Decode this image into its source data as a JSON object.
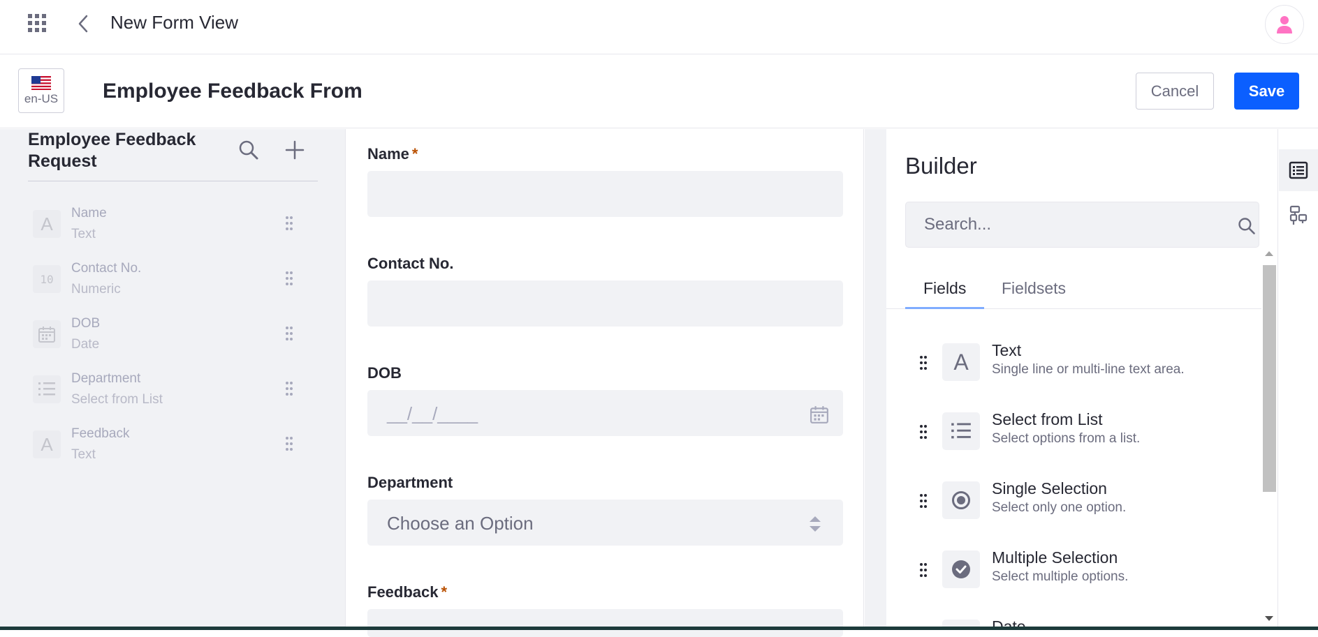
{
  "app": {
    "title": "New Form View"
  },
  "header": {
    "locale": "en-US",
    "form_title": "Employee Feedback From",
    "cancel_label": "Cancel",
    "save_label": "Save"
  },
  "left_panel": {
    "title": "Employee Feedback Request",
    "fields": [
      {
        "name": "Name",
        "type": "Text",
        "icon": "text-icon"
      },
      {
        "name": "Contact No.",
        "type": "Numeric",
        "icon": "numeric-icon"
      },
      {
        "name": "DOB",
        "type": "Date",
        "icon": "calendar-icon"
      },
      {
        "name": "Department",
        "type": "Select from List",
        "icon": "list-icon"
      },
      {
        "name": "Feedback",
        "type": "Text",
        "icon": "text-icon"
      }
    ]
  },
  "canvas": {
    "fields": [
      {
        "label": "Name",
        "required": "*",
        "placeholder": ""
      },
      {
        "label": "Contact No.",
        "required": "",
        "placeholder": ""
      },
      {
        "label": "DOB",
        "required": "",
        "placeholder": "__/__/____"
      },
      {
        "label": "Department",
        "required": "",
        "placeholder": "Choose an Option"
      },
      {
        "label": "Feedback",
        "required": "*",
        "placeholder": ""
      }
    ]
  },
  "builder": {
    "title": "Builder",
    "search_placeholder": "Search...",
    "tabs": [
      {
        "label": "Fields",
        "active": true
      },
      {
        "label": "Fieldsets",
        "active": false
      }
    ],
    "items": [
      {
        "name": "Text",
        "description": "Single line or multi-line text area.",
        "icon": "text-icon"
      },
      {
        "name": "Select from List",
        "description": "Select options from a list.",
        "icon": "list-icon"
      },
      {
        "name": "Single Selection",
        "description": "Select only one option.",
        "icon": "radio-icon"
      },
      {
        "name": "Multiple Selection",
        "description": "Select multiple options.",
        "icon": "check-circle-icon"
      },
      {
        "name": "Date",
        "description": "",
        "icon": "calendar-icon"
      }
    ]
  },
  "colors": {
    "primary": "#0b5fff",
    "required": "#b95000",
    "tab_active": "#80acff"
  }
}
